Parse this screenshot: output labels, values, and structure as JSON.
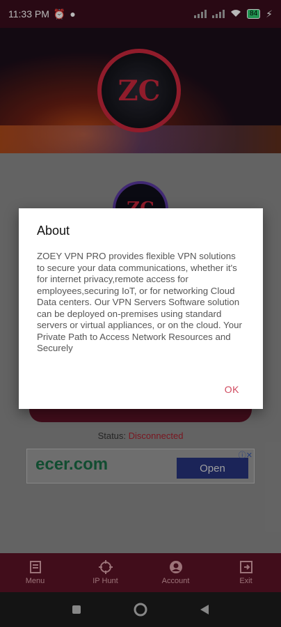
{
  "status_bar": {
    "time": "11:33 PM",
    "battery": "84"
  },
  "header": {
    "logo_text": "ZC"
  },
  "main": {
    "logo_text": "ZC"
  },
  "status": {
    "label": "Status:",
    "value": "Disconnected"
  },
  "ad": {
    "brand": "ecer.com",
    "open_label": "Open"
  },
  "dialog": {
    "title": "About",
    "body": "ZOEY VPN PRO provides flexible VPN solutions to secure your data communications, whether it's for internet privacy,remote access for employees,securing IoT, or for networking Cloud Data centers. Our VPN Servers Software solution can be deployed on-premises using standard servers or virtual appliances, or on the cloud. Your Private Path to Access Network Resources and Securely",
    "ok_label": "OK"
  },
  "bottom_nav": {
    "items": [
      {
        "label": "Menu",
        "icon": "menu-icon"
      },
      {
        "label": "IP Hunt",
        "icon": "ip-hunt-icon"
      },
      {
        "label": "Account",
        "icon": "account-icon"
      },
      {
        "label": "Exit",
        "icon": "exit-icon"
      }
    ]
  },
  "colors": {
    "primary": "#5a1326",
    "accent": "#d0495e",
    "status_disconnected": "#a8202e"
  }
}
